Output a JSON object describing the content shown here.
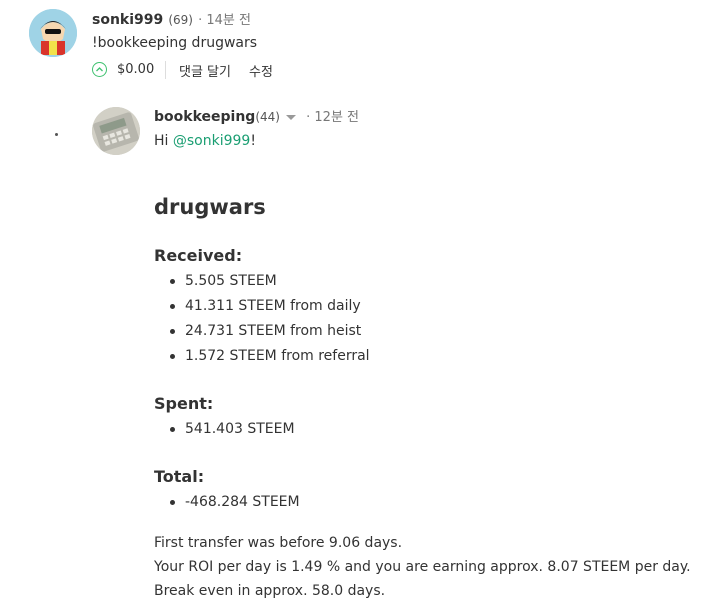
{
  "comment": {
    "username": "sonki999",
    "reputation": "(69)",
    "time": "· 14분 전",
    "body": "!bookkeeping drugwars",
    "payout": "$0.00",
    "reply_label": "댓글 달기",
    "edit_label": "수정"
  },
  "reply": {
    "username": "bookkeeping",
    "reputation": "(44)",
    "time": "· 12분 전",
    "greeting_prefix": "Hi ",
    "mention": "@sonki999",
    "greeting_suffix": "!",
    "title": "drugwars",
    "received_heading": "Received:",
    "received": [
      "5.505 STEEM",
      "41.311 STEEM from daily",
      "24.731 STEEM from heist",
      "1.572 STEEM from referral"
    ],
    "spent_heading": "Spent:",
    "spent": [
      "541.403 STEEM"
    ],
    "total_heading": "Total:",
    "total": [
      "-468.284 STEEM"
    ],
    "lines": [
      "First transfer was before 9.06 days.",
      "Your ROI per day is 1.49 % and you are earning approx. 8.07 STEEM per day.",
      "Break even in approx. 58.0 days."
    ]
  },
  "colors": {
    "link": "#1a9e72",
    "upvote": "#3ec16f"
  }
}
